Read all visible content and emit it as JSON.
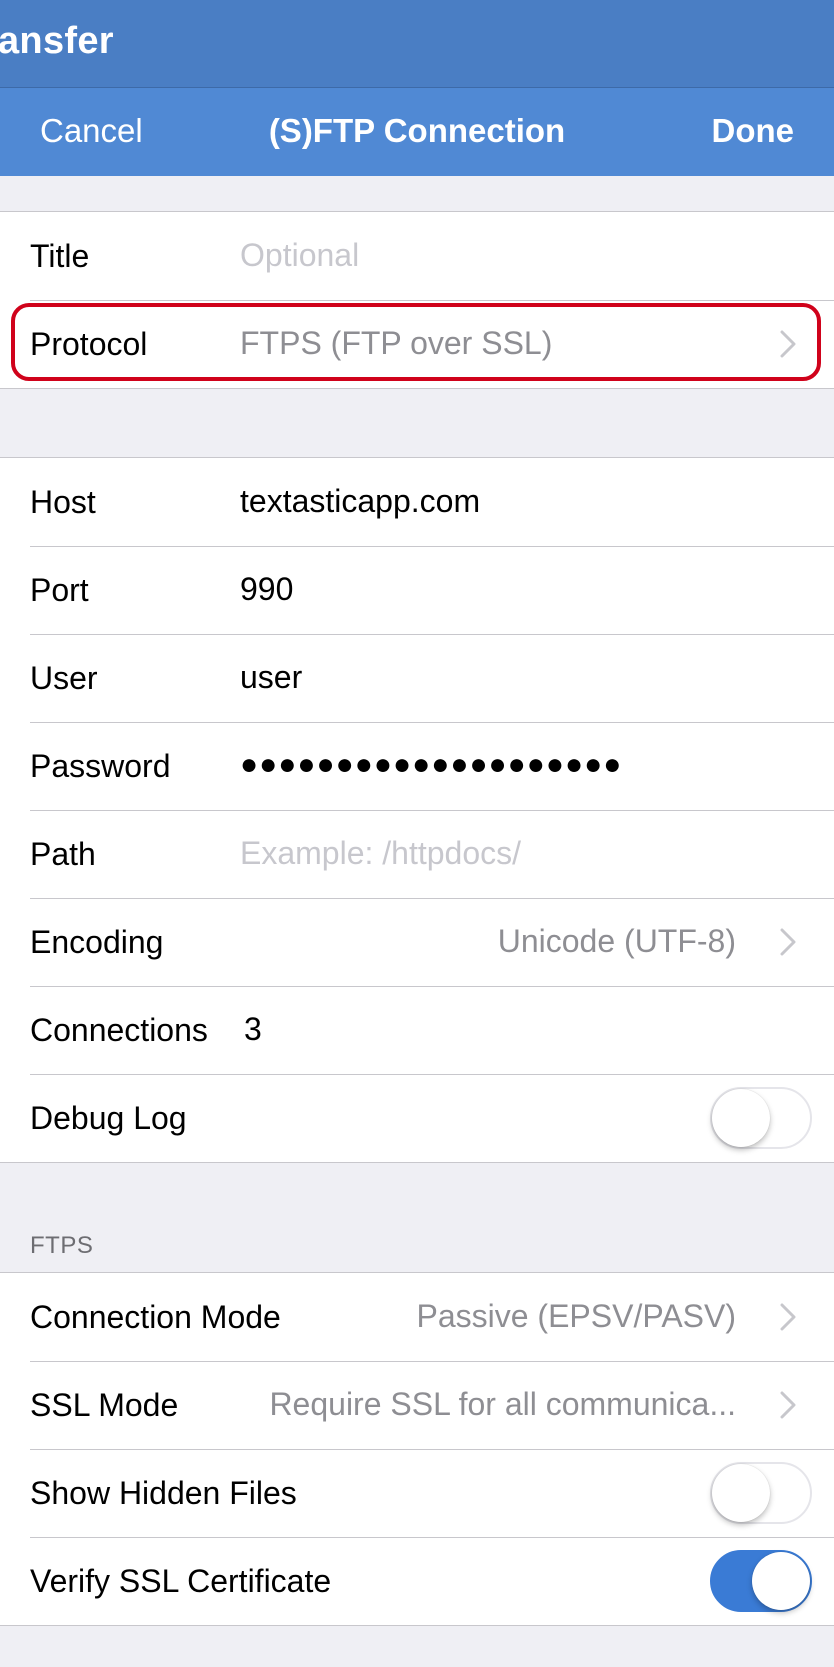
{
  "topbar": {
    "title": "ansfer"
  },
  "navbar": {
    "cancel_label": "Cancel",
    "title": "(S)FTP Connection",
    "done_label": "Done"
  },
  "group1": {
    "title_label": "Title",
    "title_placeholder": "Optional",
    "protocol_label": "Protocol",
    "protocol_value": "FTPS (FTP over SSL)"
  },
  "group2": {
    "host_label": "Host",
    "host_value": "textasticapp.com",
    "port_label": "Port",
    "port_value": "990",
    "user_label": "User",
    "user_value": "user",
    "password_label": "Password",
    "password_value": "●●●●●●●●●●●●●●●●●●●●",
    "path_label": "Path",
    "path_placeholder": "Example: /httpdocs/",
    "encoding_label": "Encoding",
    "encoding_value": "Unicode (UTF-8)",
    "connections_label": "Connections",
    "connections_value": "3",
    "debug_label": "Debug Log",
    "debug_on": false
  },
  "ftps": {
    "header": "FTPS",
    "mode_label": "Connection Mode",
    "mode_value": "Passive (EPSV/PASV)",
    "ssl_label": "SSL Mode",
    "ssl_value": "Require SSL for all communica...",
    "hidden_label": "Show Hidden Files",
    "hidden_on": false,
    "verify_label": "Verify SSL Certificate",
    "verify_on": true
  },
  "colors": {
    "topbar": "#4a7ec4",
    "navbar": "#5089d4",
    "toggle_on": "#3a7bd5",
    "highlight": "#d0021b",
    "background": "#efeff4"
  },
  "icons": {
    "disclosure": "chevron-right-icon"
  }
}
